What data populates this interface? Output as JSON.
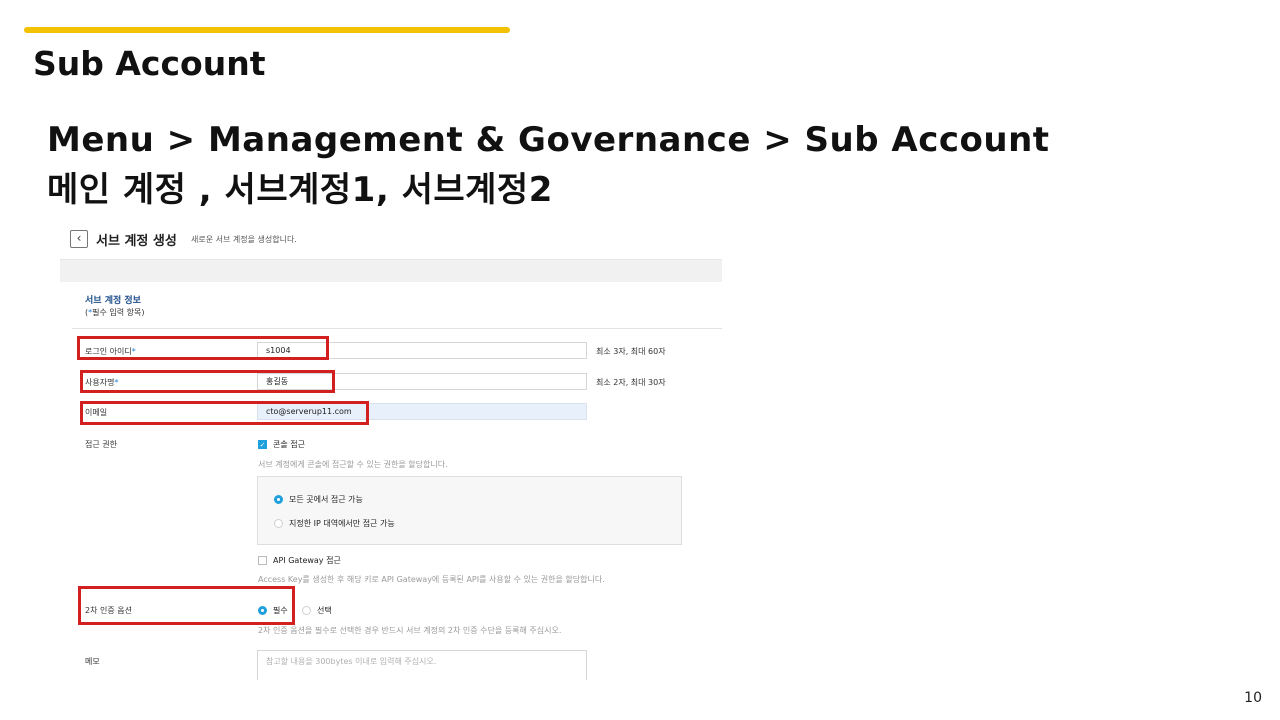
{
  "slide": {
    "title": "Sub Account",
    "path_line": "Menu > Management & Governance > Sub Account",
    "accounts_line": "메인 계정 , 서브계정1, 서브계정2",
    "page_number": "10",
    "accent_color": "#f2c200"
  },
  "screenshot": {
    "header": {
      "back_icon": "chevron-left-icon",
      "back_glyph": "‹",
      "title": "서브 계정 생성",
      "description": "새로운 서브 계정을 생성합니다."
    },
    "section": {
      "title": "서브 계정 정보",
      "required_note_open": "(",
      "required_note_star": "*",
      "required_note_rest": "필수 입력 항목)"
    },
    "fields": {
      "login_id": {
        "label": "로그인 아이디",
        "star": "*",
        "value": "s1004",
        "hint": "최소 3자, 최대 60자"
      },
      "user_name": {
        "label": "사용자명",
        "star": "*",
        "value": "홍길동",
        "hint": "최소 2자, 최대 30자"
      },
      "email": {
        "label": "이메일",
        "value": "cto@serverup11.com"
      },
      "access": {
        "label": "접근 권한",
        "console_checkbox": {
          "label": "콘솔 접근",
          "checked": true,
          "check_glyph": "✓"
        },
        "console_desc": "서브 계정에게 콘솔에 접근할 수 있는 권한을 할당합니다.",
        "radio_everywhere": {
          "label": "모든 곳에서 접근 가능",
          "selected": true
        },
        "radio_ip_range": {
          "label": "지정한 IP 대역에서만 접근 가능",
          "selected": false
        },
        "api_checkbox": {
          "label": "API Gateway 접근",
          "checked": false
        },
        "api_desc": "Access Key를 생성한 후 해당 키로 API Gateway에 등록된 API를 사용할 수 있는 권한을 할당합니다."
      },
      "two_factor": {
        "label": "2차 인증 옵션",
        "option_required": {
          "label": "필수",
          "selected": true
        },
        "option_optional": {
          "label": "선택",
          "selected": false
        },
        "desc": "2차 인증 옵션을 필수로 선택한 경우 반드시 서브 계정의 2차 인증 수단을 등록해 주십시오."
      },
      "memo": {
        "label": "메모",
        "placeholder": "참고할 내용을 300bytes 이내로 입력해 주십시오."
      }
    },
    "highlight_color": "#d21f1f",
    "accent_color": "#1ea0dc"
  }
}
